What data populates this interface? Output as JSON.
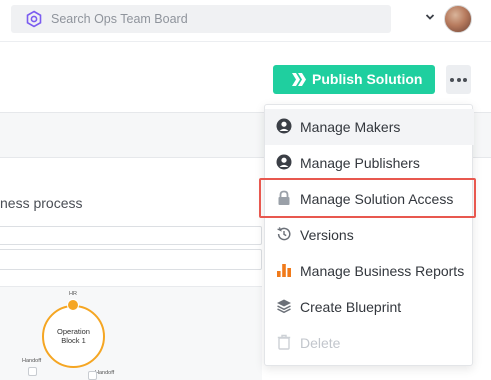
{
  "search": {
    "placeholder": "Search Ops Team Board"
  },
  "toolbar": {
    "publish_label": "Publish Solution"
  },
  "background": {
    "description_fragment": "ness process",
    "diagram": {
      "block_label_line1": "Operation",
      "block_label_line2": "Block 1",
      "badge_label": "HR",
      "handoff_left": "Handoff",
      "handoff_right": "Handoff"
    }
  },
  "menu": {
    "items": [
      {
        "label": "Manage Makers",
        "icon": "person-icon"
      },
      {
        "label": "Manage Publishers",
        "icon": "person-icon"
      },
      {
        "label": "Manage Solution Access",
        "icon": "lock-icon"
      },
      {
        "label": "Versions",
        "icon": "history-icon"
      },
      {
        "label": "Manage Business Reports",
        "icon": "bar-chart-icon"
      },
      {
        "label": "Create Blueprint",
        "icon": "layers-icon"
      },
      {
        "label": "Delete",
        "icon": "trash-icon",
        "disabled": true
      }
    ]
  },
  "colors": {
    "accent_green": "#1fcf9f",
    "highlight_red": "#e8584f",
    "chart_orange": "#f07a1a",
    "brand_purple": "#7b5cf0",
    "block_orange": "#f5a623"
  }
}
